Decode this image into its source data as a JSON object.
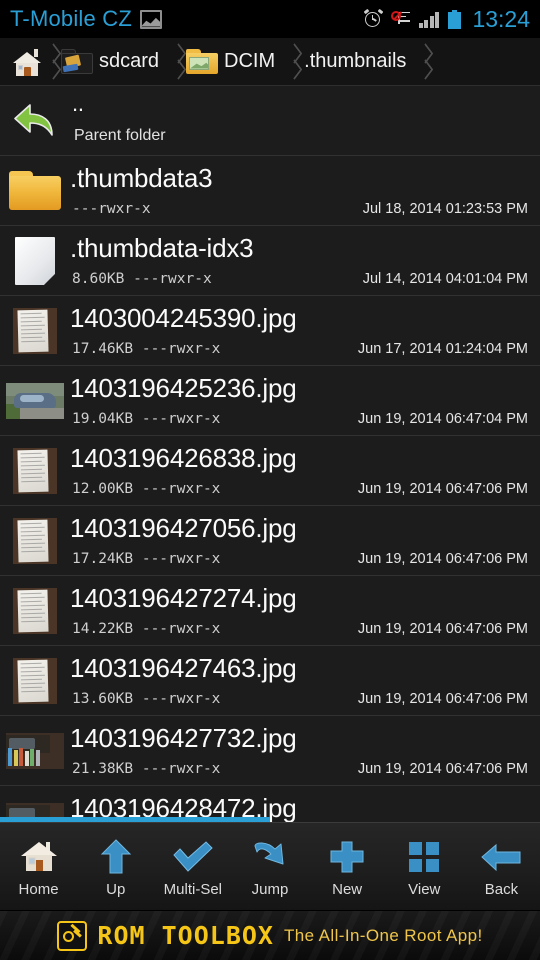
{
  "status_bar": {
    "carrier": "T-Mobile CZ",
    "time": "13:24",
    "icons": [
      "gallery-icon",
      "alarm-clock-icon",
      "mute-notifications-icon",
      "signal-bars-icon",
      "battery-icon"
    ]
  },
  "breadcrumb": {
    "items": [
      {
        "label": "",
        "icon": "home-icon"
      },
      {
        "label": "sdcard",
        "icon": "sdcard-folder-icon"
      },
      {
        "label": "DCIM",
        "icon": "dcim-folder-icon"
      },
      {
        "label": ".thumbnails",
        "icon": ""
      }
    ]
  },
  "list": {
    "parent": {
      "name": "..",
      "subtitle": "Parent folder",
      "icon": "back-arrow-green-icon"
    },
    "rows": [
      {
        "name": ".thumbdata3",
        "size": "",
        "perms": "---rwxr-x",
        "meta": "---rwxr-x",
        "date": "Jul 18, 2014 01:23:53 PM",
        "thumb": "folder"
      },
      {
        "name": ".thumbdata-idx3",
        "size": "8.60KB",
        "perms": "---rwxr-x",
        "meta": "8.60KB ---rwxr-x",
        "date": "Jul 14, 2014 04:01:04 PM",
        "thumb": "file"
      },
      {
        "name": "1403004245390.jpg",
        "size": "17.46KB",
        "perms": "---rwxr-x",
        "meta": "17.46KB ---rwxr-x",
        "date": "Jun 17, 2014 01:24:04 PM",
        "thumb": "doc"
      },
      {
        "name": "1403196425236.jpg",
        "size": "19.04KB",
        "perms": "---rwxr-x",
        "meta": "19.04KB ---rwxr-x",
        "date": "Jun 19, 2014 06:47:04 PM",
        "thumb": "car"
      },
      {
        "name": "1403196426838.jpg",
        "size": "12.00KB",
        "perms": "---rwxr-x",
        "meta": "12.00KB ---rwxr-x",
        "date": "Jun 19, 2014 06:47:06 PM",
        "thumb": "doc"
      },
      {
        "name": "1403196427056.jpg",
        "size": "17.24KB",
        "perms": "---rwxr-x",
        "meta": "17.24KB ---rwxr-x",
        "date": "Jun 19, 2014 06:47:06 PM",
        "thumb": "doc"
      },
      {
        "name": "1403196427274.jpg",
        "size": "14.22KB",
        "perms": "---rwxr-x",
        "meta": "14.22KB ---rwxr-x",
        "date": "Jun 19, 2014 06:47:06 PM",
        "thumb": "doc"
      },
      {
        "name": "1403196427463.jpg",
        "size": "13.60KB",
        "perms": "---rwxr-x",
        "meta": "13.60KB ---rwxr-x",
        "date": "Jun 19, 2014 06:47:06 PM",
        "thumb": "doc"
      },
      {
        "name": "1403196427732.jpg",
        "size": "21.38KB",
        "perms": "---rwxr-x",
        "meta": "21.38KB ---rwxr-x",
        "date": "Jun 19, 2014 06:47:06 PM",
        "thumb": "books"
      },
      {
        "name": "1403196428472.jpg",
        "size": "",
        "perms": "",
        "meta": "",
        "date": "",
        "thumb": "books"
      }
    ]
  },
  "toolbar": {
    "buttons": [
      {
        "label": "Home",
        "icon": "home-icon"
      },
      {
        "label": "Up",
        "icon": "arrow-up-icon"
      },
      {
        "label": "Multi-Sel",
        "icon": "checkmark-icon"
      },
      {
        "label": "Jump",
        "icon": "curved-arrow-icon"
      },
      {
        "label": "New",
        "icon": "plus-icon"
      },
      {
        "label": "View",
        "icon": "grid-icon"
      },
      {
        "label": "Back",
        "icon": "arrow-left-icon"
      }
    ]
  },
  "ad": {
    "brand": "ROM TOOLBOX",
    "tagline": "The All-In-One Root App!",
    "logo_icon": "romtoolbox-logo-icon"
  },
  "colors": {
    "accent_blue": "#2a9fd6",
    "toolbar_icon_blue": "#3a8fc4",
    "folder_orange": "#f0b73c",
    "ad_yellow": "#f5c518",
    "list_bg": "#1c1c1c"
  }
}
